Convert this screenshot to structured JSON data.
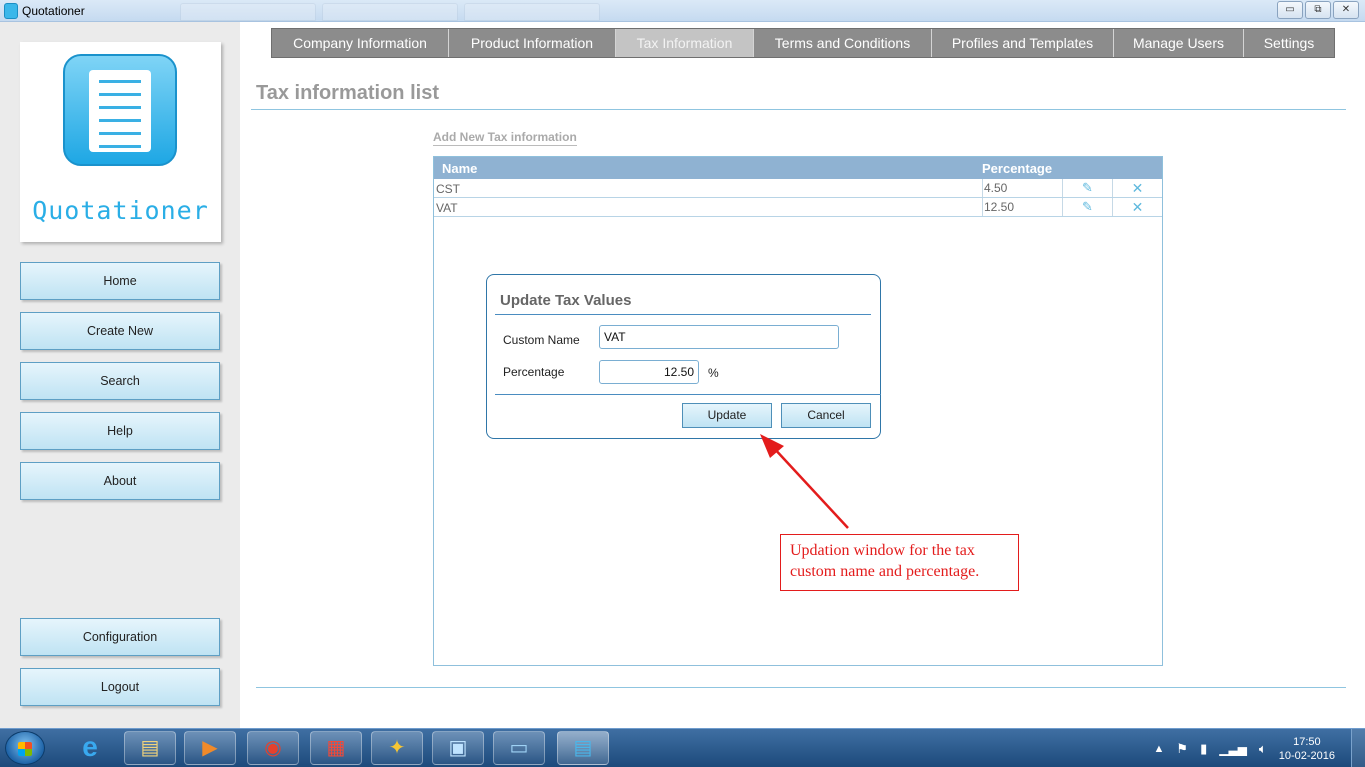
{
  "window": {
    "title": "Quotationer",
    "minimize_glyph": "▭",
    "maximize_glyph": "⧉",
    "close_glyph": "✕"
  },
  "sidebar": {
    "logo_text": "Quotationer",
    "buttons": [
      {
        "label": "Home"
      },
      {
        "label": "Create New"
      },
      {
        "label": "Search"
      },
      {
        "label": "Help"
      },
      {
        "label": "About"
      }
    ],
    "bottom_buttons": [
      {
        "label": "Configuration"
      },
      {
        "label": "Logout"
      }
    ]
  },
  "nav": {
    "tabs": [
      {
        "label": "Company Information"
      },
      {
        "label": "Product Information"
      },
      {
        "label": "Tax Information"
      },
      {
        "label": "Terms and Conditions"
      },
      {
        "label": "Profiles and Templates"
      },
      {
        "label": "Manage Users"
      },
      {
        "label": "Settings"
      }
    ],
    "active_tab": "Tax Information"
  },
  "main": {
    "page_title": "Tax information list",
    "add_link": "Add New Tax information",
    "table": {
      "headers": {
        "name": "Name",
        "percentage": "Percentage"
      },
      "rows": [
        {
          "name": "CST",
          "percentage": "4.50",
          "edit_icon": "✎",
          "delete_icon": "✕"
        },
        {
          "name": "VAT",
          "percentage": "12.50",
          "edit_icon": "✎",
          "delete_icon": "✕"
        }
      ]
    }
  },
  "dialog": {
    "title": "Update Tax Values",
    "custom_name_label": "Custom Name",
    "custom_name_value": "VAT",
    "percentage_label": "Percentage",
    "percentage_value": "12.50",
    "percent_sign": "%",
    "update_label": "Update",
    "cancel_label": "Cancel"
  },
  "annotation": {
    "line1": "Updation window for the tax",
    "line2": "custom name and percentage.",
    "color": "#e31c1c"
  },
  "taskbar": {
    "items": [
      {
        "icon": "internet-explorer-icon",
        "glyph": "e"
      },
      {
        "icon": "file-explorer-icon",
        "glyph": "▤"
      },
      {
        "icon": "media-player-icon",
        "glyph": "▶"
      },
      {
        "icon": "chrome-icon",
        "glyph": "◉"
      },
      {
        "icon": "apps-grid-icon",
        "glyph": "▦"
      },
      {
        "icon": "lightbulb-icon",
        "glyph": "✦"
      },
      {
        "icon": "control-panel-icon",
        "glyph": "▣"
      },
      {
        "icon": "photo-viewer-icon",
        "glyph": "▭"
      },
      {
        "icon": "quotationer-icon",
        "glyph": "▤"
      }
    ],
    "tray_arrow": "▲",
    "time": "17:50",
    "date": "10-02-2016"
  },
  "colors": {
    "accent": "#2aaee6",
    "nav_bg": "#8c8c8c",
    "table_header_bg": "#8fb2d2",
    "dialog_border": "#2f76a8"
  }
}
